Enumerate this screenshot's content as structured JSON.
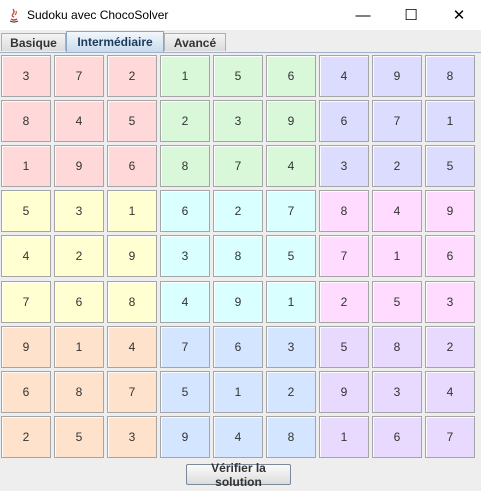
{
  "window": {
    "title": "Sudoku avec ChocoSolver",
    "minimize_glyph": "—",
    "maximize_glyph": "☐",
    "close_glyph": "✕"
  },
  "tabs": [
    {
      "label": "Basique",
      "selected": false
    },
    {
      "label": "Intermédiaire",
      "selected": true
    },
    {
      "label": "Avancé",
      "selected": false
    }
  ],
  "grid": {
    "rows": [
      [
        "3",
        "7",
        "2",
        "1",
        "5",
        "6",
        "4",
        "9",
        "8"
      ],
      [
        "8",
        "4",
        "5",
        "2",
        "3",
        "9",
        "6",
        "7",
        "1"
      ],
      [
        "1",
        "9",
        "6",
        "8",
        "7",
        "4",
        "3",
        "2",
        "5"
      ],
      [
        "5",
        "3",
        "1",
        "6",
        "2",
        "7",
        "8",
        "4",
        "9"
      ],
      [
        "4",
        "2",
        "9",
        "3",
        "8",
        "5",
        "7",
        "1",
        "6"
      ],
      [
        "7",
        "6",
        "8",
        "4",
        "9",
        "1",
        "2",
        "5",
        "3"
      ],
      [
        "9",
        "1",
        "4",
        "7",
        "6",
        "3",
        "5",
        "8",
        "2"
      ],
      [
        "6",
        "8",
        "7",
        "5",
        "1",
        "2",
        "9",
        "3",
        "4"
      ],
      [
        "2",
        "5",
        "3",
        "9",
        "4",
        "8",
        "1",
        "6",
        "7"
      ]
    ],
    "block_colors": [
      [
        "#ffd9da",
        "#d9f8d9",
        "#dcdcff"
      ],
      [
        "#ffffd2",
        "#d9ffff",
        "#ffdcff"
      ],
      [
        "#ffe2cc",
        "#d4e6ff",
        "#e8d9ff"
      ]
    ]
  },
  "verify_button": {
    "label": "Vérifier la solution"
  }
}
